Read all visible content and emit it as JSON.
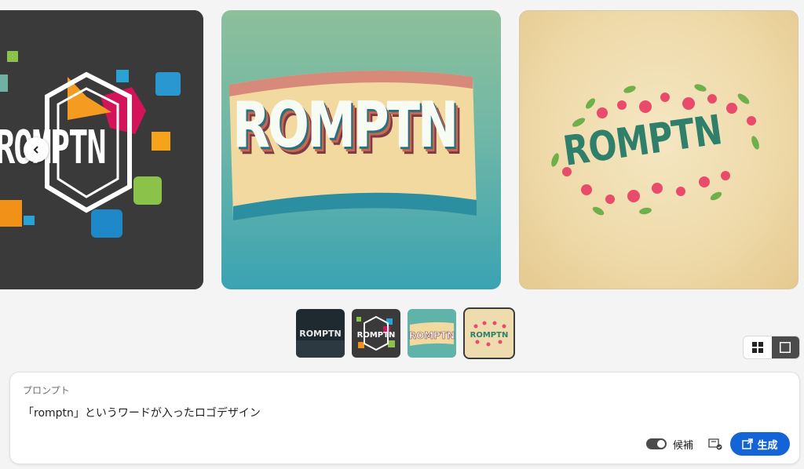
{
  "gallery": {
    "images": [
      {
        "name": "logo-variant-geometric",
        "logo_text": "ROMPTN"
      },
      {
        "name": "logo-variant-retro",
        "logo_text": "ROMPTN"
      },
      {
        "name": "logo-variant-floral",
        "logo_text": "ROMPTN"
      }
    ],
    "thumbnails": [
      {
        "logo_text": "ROMPTN",
        "selected": false
      },
      {
        "logo_text": "ROMPTN",
        "selected": false
      },
      {
        "logo_text": "ROMPTN",
        "selected": false
      },
      {
        "logo_text": "ROMPTN",
        "selected": true
      }
    ],
    "prev_icon": "chevron-left-icon"
  },
  "view_toggle": {
    "grid_icon": "grid-icon",
    "single_icon": "single-view-icon",
    "active": "single"
  },
  "prompt": {
    "label": "プロンプト",
    "text": "「romptn」というワードが入ったロゴデザイン",
    "suggestions_label": "候補",
    "suggestions_enabled": true,
    "generate_label": "生成",
    "generate_icon": "generate-icon",
    "settings_icon": "style-settings-icon",
    "accent_color": "#1464d8"
  }
}
